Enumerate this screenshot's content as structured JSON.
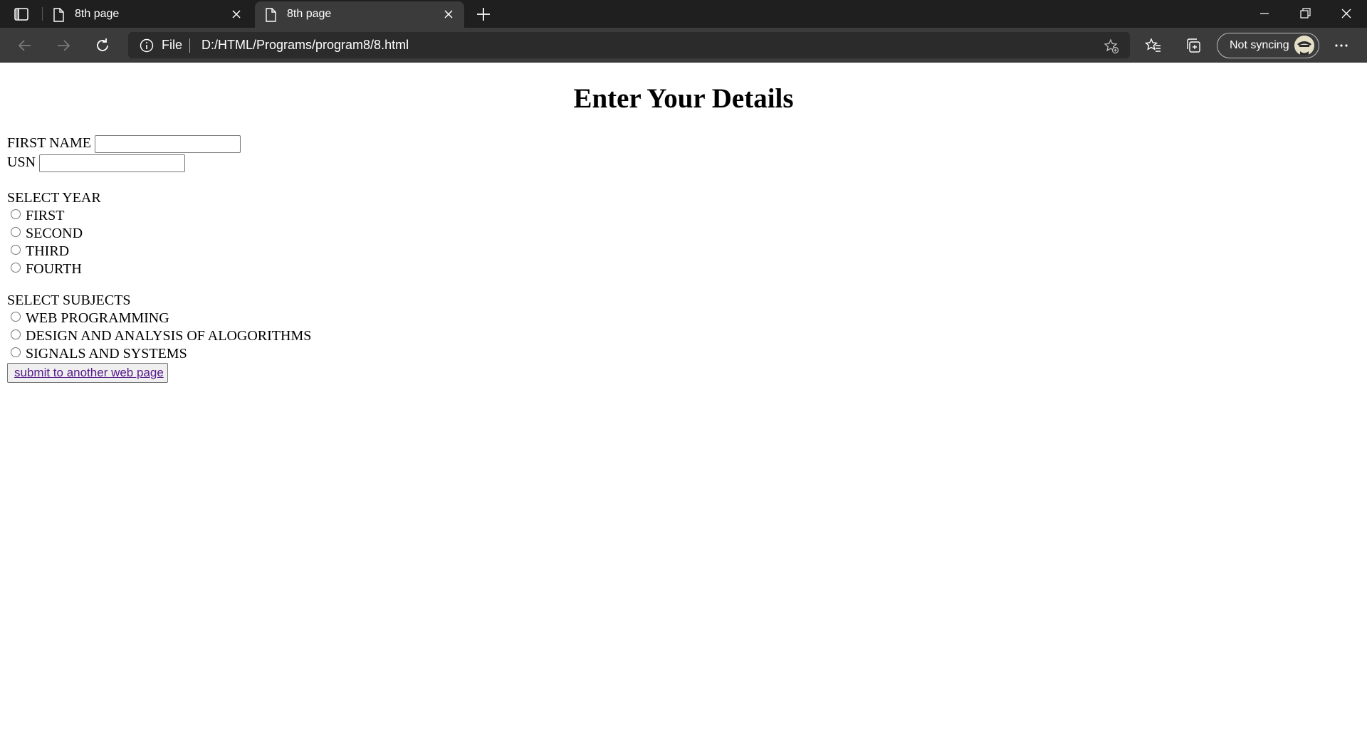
{
  "browser": {
    "tabs": [
      {
        "title": "8th page",
        "active": false
      },
      {
        "title": "8th page",
        "active": true
      }
    ],
    "address": {
      "scheme_label": "File",
      "url": "D:/HTML/Programs/program8/8.html"
    },
    "profile": {
      "label": "Not syncing"
    }
  },
  "page": {
    "heading": "Enter Your Details",
    "first_name_label": "FIRST NAME",
    "usn_label": "USN",
    "year_heading": "SELECT YEAR",
    "years": [
      "FIRST",
      "SECOND",
      "THIRD",
      "FOURTH"
    ],
    "subjects_heading": "SELECT SUBJECTS",
    "subjects": [
      "WEB PROGRAMMING",
      "DESIGN AND ANALYSIS OF ALOGORITHMS",
      "SIGNALS AND SYSTEMS"
    ],
    "submit_label": "submit to another web page"
  },
  "colors": {
    "tabbar_bg": "#1f1f1f",
    "toolbar_bg": "#3b3b3b",
    "address_bg": "#2b2b2b",
    "visited_link": "#551a8b"
  }
}
